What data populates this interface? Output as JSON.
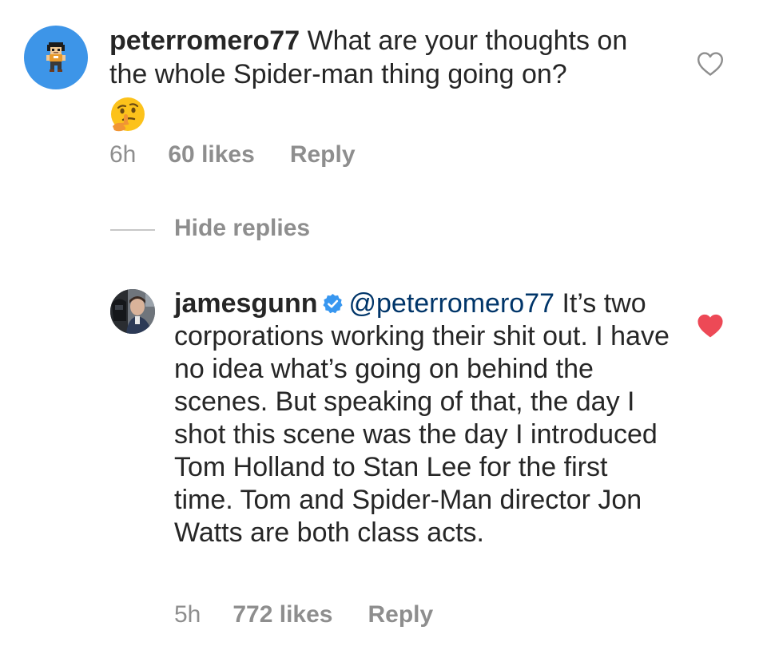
{
  "comment": {
    "username": "peterromero77",
    "text": "What are your thoughts on the whole Spider-man thing going on?",
    "emoji": "🤔",
    "time": "6h",
    "likes": "60 likes",
    "reply_label": "Reply",
    "liked": false,
    "avatar_color": "#3d95e8"
  },
  "hide_replies_label": "Hide replies",
  "reply": {
    "username": "jamesgunn",
    "verified": true,
    "mention": "@peterromero77",
    "text": "It’s two corporations working their shit out. I have no idea what’s going on behind the scenes. But speaking of that, the day I shot this scene was the day I introduced Tom Holland to Stan Lee for the first time. Tom and Spider-Man director Jon Watts are both class acts.",
    "time": "5h",
    "likes": "772 likes",
    "reply_label": "Reply",
    "liked": true
  },
  "colors": {
    "text": "#262626",
    "secondary": "#8e8e8e",
    "mention": "#003569",
    "verified": "#3897f0",
    "liked_heart": "#ed4956"
  },
  "icons": {
    "like_empty": "heart-outline-icon",
    "like_filled": "heart-filled-icon",
    "verified": "verified-badge-icon",
    "emoji": "thinking-face-emoji"
  }
}
